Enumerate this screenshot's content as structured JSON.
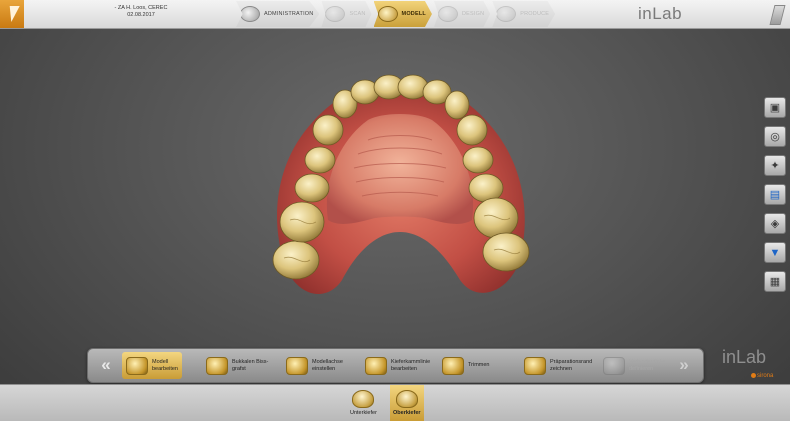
{
  "header": {
    "case_line": "- ZA H. Loos, CEREC",
    "case_date": "02.08.2017",
    "steps": [
      {
        "label": "ADMINISTRATION",
        "state": "normal",
        "icon": "administration-icon"
      },
      {
        "label": "SCAN",
        "state": "disabled",
        "icon": "scan-icon"
      },
      {
        "label": "MODELL",
        "state": "active",
        "icon": "model-icon"
      },
      {
        "label": "DESIGN",
        "state": "disabled",
        "icon": "design-icon"
      },
      {
        "label": "PRODUCE",
        "state": "disabled",
        "icon": "produce-icon"
      }
    ],
    "brand": "inLab"
  },
  "right_tools": [
    {
      "name": "view-cube-icon",
      "glyph": "▣"
    },
    {
      "name": "rotate-icon",
      "glyph": "◎"
    },
    {
      "name": "magic-wand-icon",
      "glyph": "✦"
    },
    {
      "name": "screenshot-icon",
      "glyph": "▤"
    },
    {
      "name": "model-settings-icon",
      "glyph": "◈"
    },
    {
      "name": "save-icon",
      "glyph": "▼"
    },
    {
      "name": "catalog-icon",
      "glyph": "▦"
    }
  ],
  "toolbar": {
    "prev_glyph": "«",
    "next_glyph": "»",
    "items": [
      {
        "line1": "Modell",
        "line2": "bearbeiten",
        "state": "active"
      },
      {
        "line1": "Bukkalen Biss-",
        "line2": "grafst",
        "state": "normal"
      },
      {
        "line1": "Modellachse",
        "line2": "einstellen",
        "state": "normal"
      },
      {
        "line1": "Kieferkammlinie",
        "line2": "bearbeiten",
        "state": "normal"
      },
      {
        "line1": "Trimmen",
        "line2": "",
        "state": "normal"
      },
      {
        "line1": "Präparationsrand",
        "line2": "zeichnen",
        "state": "normal"
      },
      {
        "line1": "Verbinderdicke",
        "line2": "definieren",
        "state": "disabled"
      }
    ]
  },
  "jaws": [
    {
      "label": "Unterkiefer",
      "state": "normal"
    },
    {
      "label": "Oberkiefer",
      "state": "active"
    }
  ],
  "brand_bottom": "inLab",
  "sub_brand": "sirona",
  "colors": {
    "accent_gold": "#caa03a",
    "menu_orange": "#c97a12",
    "brand_orange": "#e07c16",
    "gum": "#c8574c",
    "tooth": "#e4cf8a"
  }
}
